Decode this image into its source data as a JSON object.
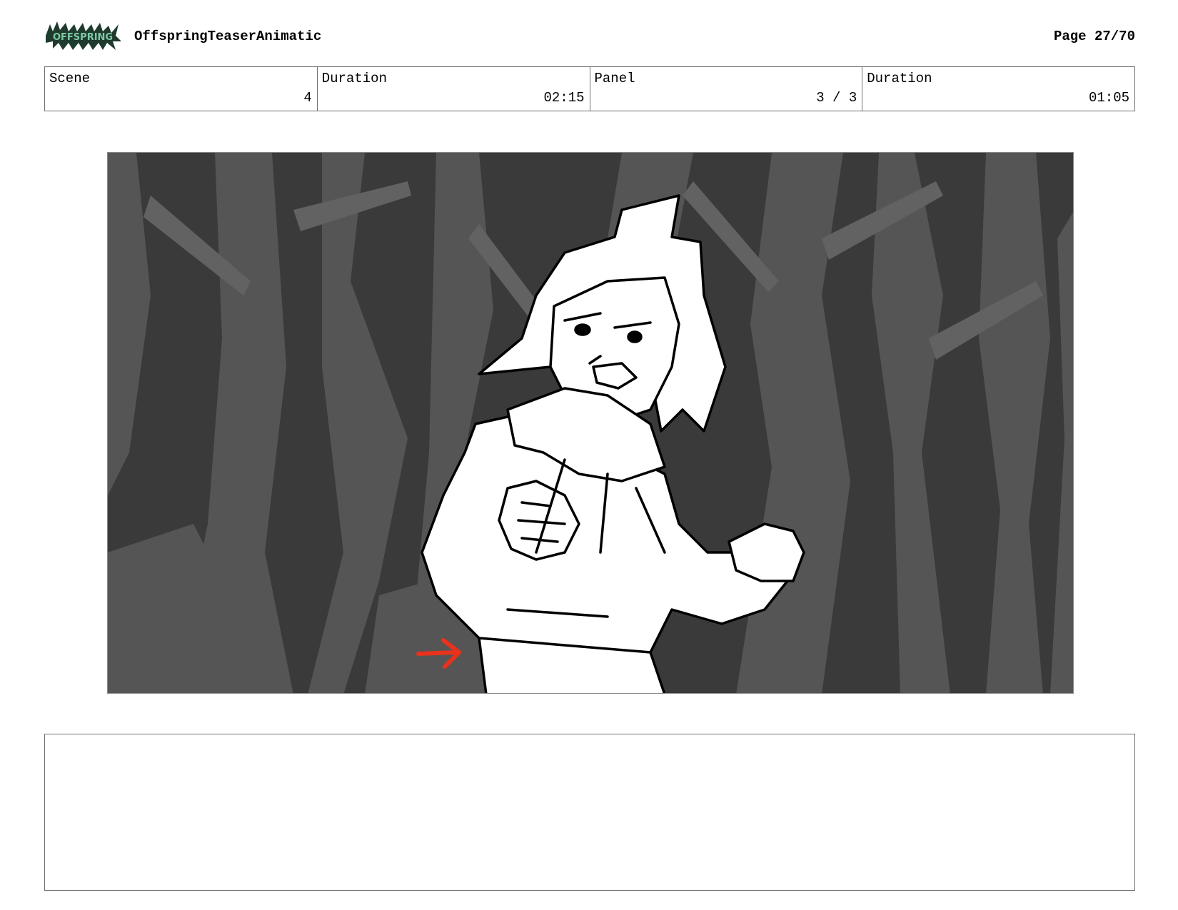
{
  "header": {
    "logo_text": "OFFSPRING",
    "project_title": "OffspringTeaserAnimatic",
    "page": "Page 27/70"
  },
  "info": {
    "scene_label": "Scene",
    "scene_value": "4",
    "scene_duration_label": "Duration",
    "scene_duration_value": "02:15",
    "panel_label": "Panel",
    "panel_value": "3 / 3",
    "panel_duration_label": "Duration",
    "panel_duration_value": "01:05"
  },
  "panel": {
    "accent_arrow_color": "#e8321c"
  },
  "notes": {
    "text": ""
  }
}
